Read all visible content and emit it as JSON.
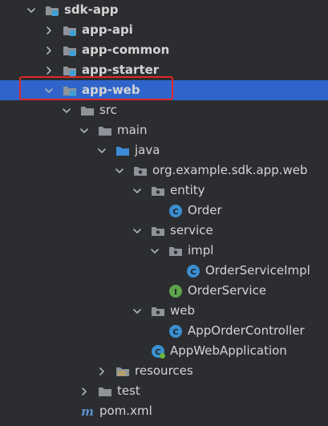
{
  "tree": [
    {
      "label": "sdk-app",
      "depth": 0,
      "arrow": "down",
      "icon": "module-folder-icon",
      "bold": true,
      "name": "tree-item-sdk-app"
    },
    {
      "label": "app-api",
      "depth": 1,
      "arrow": "right",
      "icon": "module-folder-icon",
      "bold": true,
      "name": "tree-item-app-api"
    },
    {
      "label": "app-common",
      "depth": 1,
      "arrow": "right",
      "icon": "module-folder-icon",
      "bold": true,
      "name": "tree-item-app-common"
    },
    {
      "label": "app-starter",
      "depth": 1,
      "arrow": "right",
      "icon": "module-folder-icon",
      "bold": true,
      "name": "tree-item-app-starter"
    },
    {
      "label": "app-web",
      "depth": 1,
      "arrow": "down",
      "icon": "module-folder-icon",
      "bold": true,
      "selected": true,
      "name": "tree-item-app-web"
    },
    {
      "label": "src",
      "depth": 2,
      "arrow": "down",
      "icon": "folder-icon",
      "name": "tree-item-src"
    },
    {
      "label": "main",
      "depth": 3,
      "arrow": "down",
      "icon": "folder-icon",
      "name": "tree-item-main"
    },
    {
      "label": "java",
      "depth": 4,
      "arrow": "down",
      "icon": "source-folder-icon",
      "name": "tree-item-java"
    },
    {
      "label": "org.example.sdk.app.web",
      "depth": 5,
      "arrow": "down",
      "icon": "package-icon",
      "name": "tree-item-package"
    },
    {
      "label": "entity",
      "depth": 6,
      "arrow": "down",
      "icon": "package-icon",
      "name": "tree-item-entity"
    },
    {
      "label": "Order",
      "depth": 7,
      "arrow": "none",
      "icon": "class-icon",
      "name": "tree-item-order"
    },
    {
      "label": "service",
      "depth": 6,
      "arrow": "down",
      "icon": "package-icon",
      "name": "tree-item-service"
    },
    {
      "label": "impl",
      "depth": 7,
      "arrow": "down",
      "icon": "package-icon",
      "name": "tree-item-impl"
    },
    {
      "label": "OrderServiceImpl",
      "depth": 8,
      "arrow": "none",
      "icon": "class-icon",
      "name": "tree-item-order-service-impl"
    },
    {
      "label": "OrderService",
      "depth": 7,
      "arrow": "none",
      "icon": "interface-icon",
      "name": "tree-item-order-service"
    },
    {
      "label": "web",
      "depth": 6,
      "arrow": "down",
      "icon": "package-icon",
      "name": "tree-item-web"
    },
    {
      "label": "AppOrderController",
      "depth": 7,
      "arrow": "none",
      "icon": "class-icon",
      "name": "tree-item-app-order-controller"
    },
    {
      "label": "AppWebApplication",
      "depth": 6,
      "arrow": "none",
      "icon": "spring-class-icon",
      "name": "tree-item-app-web-application"
    },
    {
      "label": "resources",
      "depth": 4,
      "arrow": "right",
      "icon": "resources-folder-icon",
      "name": "tree-item-resources"
    },
    {
      "label": "test",
      "depth": 3,
      "arrow": "right",
      "icon": "folder-icon",
      "name": "tree-item-test"
    },
    {
      "label": "pom.xml",
      "depth": 2,
      "arrow": "none",
      "icon": "maven-icon",
      "name": "tree-item-pom-xml"
    }
  ],
  "colors": {
    "background": "#2b2d30",
    "text": "#d4d4d4",
    "highlight_border": "#e02828",
    "folder": "#8e9399",
    "source_folder": "#3d8bd6",
    "module_badge": "#3aa0d9",
    "class_icon": "#3b8fd1",
    "interface_icon": "#5ea34a"
  }
}
